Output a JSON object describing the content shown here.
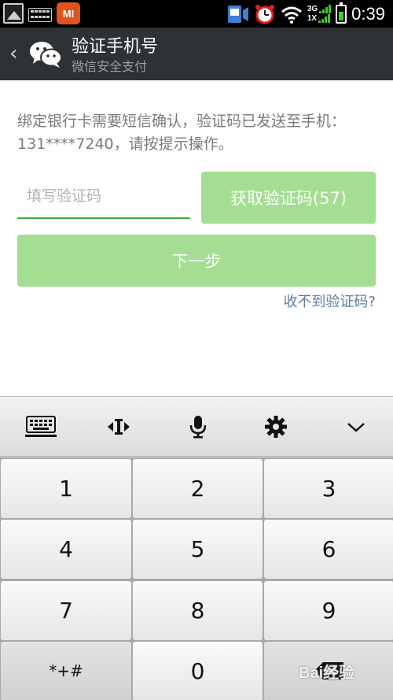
{
  "status_bar": {
    "time": "0:39",
    "network_top": "3G",
    "network_bottom": "1X",
    "mi_label": "MI"
  },
  "header": {
    "back_glyph": "‹",
    "title": "验证手机号",
    "subtitle": "微信安全支付"
  },
  "content": {
    "description": "绑定银行卡需要短信确认，验证码已发送至手机：131****7240，请按提示操作。",
    "code_input_placeholder": "填写验证码",
    "get_code_label": "获取验证码(57)",
    "next_label": "下一步",
    "no_code_link": "收不到验证码?"
  },
  "keyboard": {
    "toolbar": [
      "keyboard-icon",
      "cursor-move-icon",
      "microphone-icon",
      "gear-icon",
      "chevron-down-icon"
    ],
    "keys": [
      {
        "label": "1"
      },
      {
        "label": "2"
      },
      {
        "label": "3"
      },
      {
        "label": "4"
      },
      {
        "label": "5"
      },
      {
        "label": "6"
      },
      {
        "label": "7"
      },
      {
        "label": "8"
      },
      {
        "label": "9"
      },
      {
        "label": "*+#"
      },
      {
        "label": "0"
      },
      {
        "label": ""
      }
    ]
  },
  "watermark": "Bai经验",
  "colors": {
    "status_bar": "#000000",
    "header": "#2e3235",
    "button_disabled": "#a3de92",
    "input_underline": "#3bb33b",
    "link": "#5d7ea2",
    "keyboard_bg": "#d8d9db"
  }
}
